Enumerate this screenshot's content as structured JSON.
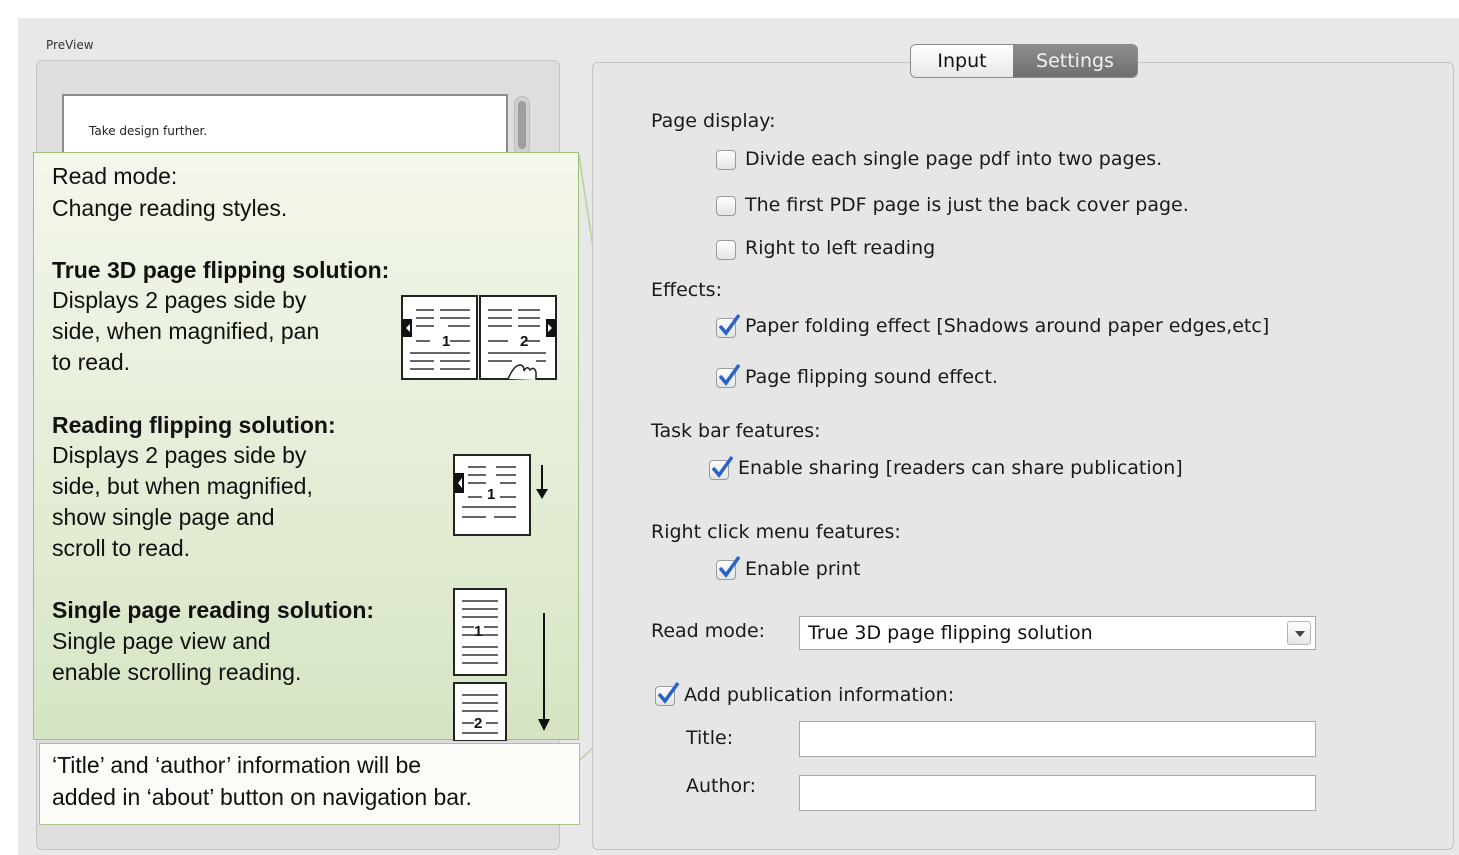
{
  "preview": {
    "label": "PreView",
    "page_text": "Take design further."
  },
  "callout": {
    "intro_line1": "Read mode:",
    "intro_line2": "Change reading styles.",
    "true3d": {
      "heading": "True 3D page flipping solution:",
      "lines": [
        "Displays 2 pages side by",
        "side, when magnified, pan",
        "to read."
      ]
    },
    "reading": {
      "heading": "Reading flipping solution:",
      "lines": [
        "Displays 2 pages side by",
        "side, but when magnified,",
        "show  single  page  and",
        "scroll to read."
      ]
    },
    "single": {
      "heading": "Single page reading solution:",
      "lines": [
        "Single  page  view  and",
        "enable scrolling reading."
      ]
    },
    "bottom": {
      "line1": "‘Title’  and  ‘author’  information  will  be",
      "line2": "added in ‘about’ button on navigation bar."
    },
    "icon_labels": {
      "page1": "1",
      "page2": "2"
    }
  },
  "tabs": {
    "input": "Input",
    "settings": "Settings"
  },
  "settings": {
    "page_display": {
      "label": "Page display:",
      "options": [
        {
          "label": "Divide each single page pdf into two pages.",
          "checked": false
        },
        {
          "label": "The first PDF page is just the back cover page.",
          "checked": false
        },
        {
          "label": "Right to left reading",
          "checked": false
        }
      ]
    },
    "effects": {
      "label": "Effects:",
      "options": [
        {
          "label": "Paper folding effect [Shadows around paper edges,etc]",
          "checked": true
        },
        {
          "label": "Page flipping sound effect.",
          "checked": true
        }
      ]
    },
    "task_bar": {
      "label": "Task bar features:",
      "options": [
        {
          "label": "Enable sharing [readers can share publication]",
          "checked": true
        }
      ]
    },
    "right_click": {
      "label": "Right click menu features:",
      "options": [
        {
          "label": "Enable print",
          "checked": true
        }
      ]
    },
    "read_mode": {
      "label": "Read mode:",
      "value": "True 3D page flipping solution"
    },
    "publication": {
      "label": "Add publication information:",
      "checked": true,
      "title_label": "Title:",
      "title_value": "",
      "author_label": "Author:",
      "author_value": ""
    }
  },
  "colors": {
    "callout_border": "#9fc07b",
    "check": "#2a63c8",
    "tab_active": "#7a7a7a"
  }
}
